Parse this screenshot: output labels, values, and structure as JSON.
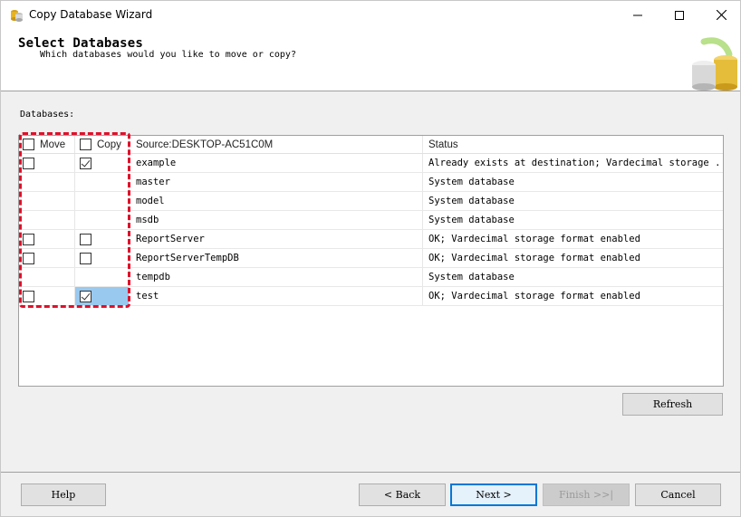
{
  "window": {
    "title": "Copy Database Wizard"
  },
  "header": {
    "title": "Select Databases",
    "subtitle": "Which databases would you like to move or copy?"
  },
  "databases_label": "Databases:",
  "grid": {
    "columns": {
      "move": "Move",
      "copy": "Copy",
      "source": "Source:DESKTOP-AC51C0M",
      "status": "Status"
    },
    "rows": [
      {
        "name": "example",
        "status": "Already exists at destination; Vardecimal storage ...",
        "move": false,
        "copy": true,
        "move_available": true,
        "copy_available": true
      },
      {
        "name": "master",
        "status": "System database",
        "move_available": false,
        "copy_available": false
      },
      {
        "name": "model",
        "status": "System database",
        "move_available": false,
        "copy_available": false
      },
      {
        "name": "msdb",
        "status": "System database",
        "move_available": false,
        "copy_available": false
      },
      {
        "name": "ReportServer",
        "status": "OK; Vardecimal storage format enabled",
        "move": false,
        "copy": false,
        "move_available": true,
        "copy_available": true
      },
      {
        "name": "ReportServerTempDB",
        "status": "OK; Vardecimal storage format enabled",
        "move": false,
        "copy": false,
        "move_available": true,
        "copy_available": true
      },
      {
        "name": "tempdb",
        "status": "System database",
        "move_available": false,
        "copy_available": false
      },
      {
        "name": "test",
        "status": "OK; Vardecimal storage format enabled",
        "move": false,
        "copy": true,
        "move_available": true,
        "copy_available": true,
        "copy_selected": true
      }
    ]
  },
  "buttons": {
    "refresh": "Refresh",
    "help": "Help",
    "back": "< Back",
    "next": "Next >",
    "finish": "Finish >>|",
    "cancel": "Cancel"
  },
  "colors": {
    "selection": "#99c9ef",
    "highlight_dash": "#e0102a",
    "primary_border": "#0078d7"
  },
  "icons": {
    "app": "database-wizard-icon",
    "header_art": "database-cylinders-art",
    "minimize": "minimize-icon",
    "maximize": "maximize-icon",
    "close": "close-icon"
  }
}
